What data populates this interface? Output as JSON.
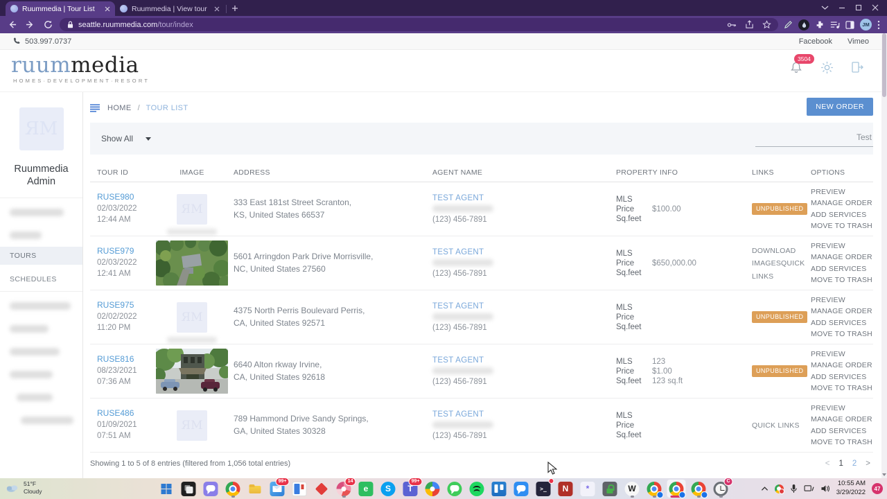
{
  "browser": {
    "tabs": [
      {
        "title": "Ruummedia | Tour List"
      },
      {
        "title": "Ruummedia | View tour"
      }
    ],
    "url_domain": "seattle.ruummedia.com",
    "url_path": "/tour/index",
    "profile_initials": "JM"
  },
  "site": {
    "topbar": {
      "phone": "503.997.0737",
      "link1": "Facebook",
      "link2": "Vimeo"
    },
    "header": {
      "logo_blue": "ruum",
      "logo_dark": "media",
      "tagline": "HOMES·DEVELOPMENT·RESORT",
      "notification_count": "3504"
    },
    "sidebar": {
      "profile_line1": "Ruummedia",
      "profile_line2": "Admin",
      "tours_label": "TOURS",
      "schedules_label": "SCHEDULES"
    },
    "breadcrumb": {
      "home": "HOME",
      "separator": "/",
      "current": "TOUR LIST"
    },
    "new_order_label": "NEW ORDER",
    "filter_label": "Show All",
    "search_value": "Test",
    "table": {
      "headers": [
        "TOUR ID",
        "IMAGE",
        "ADDRESS",
        "AGENT NAME",
        "PROPERTY INFO",
        "LINKS",
        "OPTIONS"
      ],
      "property_labels": [
        "MLS",
        "Price",
        "Sq.feet"
      ],
      "options": [
        "PREVIEW",
        "MANAGE ORDER",
        "ADD SERVICES",
        "MOVE TO TRASH"
      ],
      "rows": [
        {
          "tour_id": "RUSE980",
          "date": "02/03/2022",
          "time": "12:44 AM",
          "image": "placeholder",
          "caption_redacted": true,
          "address_line1": "333 East 181st Street Scranton,",
          "address_line2": "KS, United States 66537",
          "agent_name": "TEST AGENT",
          "agent_phone": "(123) 456-7891",
          "mls": "",
          "price": "$100.00",
          "sqfeet": "",
          "links": [],
          "badge": "UNPUBLISHED"
        },
        {
          "tour_id": "RUSE979",
          "date": "02/03/2022",
          "time": "12:41 AM",
          "image": "photo-aerial",
          "address_line1": "5601 Arringdon Park Drive Morrisville,",
          "address_line2": "NC, United States 27560",
          "agent_name": "TEST AGENT",
          "agent_phone": "(123) 456-7891",
          "mls": "",
          "price": "$650,000.00",
          "sqfeet": "",
          "links": [
            "DOWNLOAD IMAGES",
            "QUICK LINKS"
          ],
          "badge": ""
        },
        {
          "tour_id": "RUSE975",
          "date": "02/02/2022",
          "time": "11:20 PM",
          "image": "placeholder",
          "caption_redacted": true,
          "address_line1": "4375 North Perris Boulevard Perris,",
          "address_line2": "CA, United States 92571",
          "agent_name": "TEST AGENT",
          "agent_phone": "(123) 456-7891",
          "mls": "",
          "price": "",
          "sqfeet": "",
          "links": [],
          "badge": "UNPUBLISHED"
        },
        {
          "tour_id": "RUSE816",
          "date": "08/23/2021",
          "time": "07:36 AM",
          "image": "photo-building",
          "address_line1": "6640 Alton rkway Irvine,",
          "address_line2": "CA, United States 92618",
          "agent_name": "TEST AGENT",
          "agent_phone": "(123) 456-7891",
          "mls": "123",
          "price": "$1.00",
          "sqfeet": "123 sq.ft",
          "links": [],
          "badge": "UNPUBLISHED"
        },
        {
          "tour_id": "RUSE486",
          "date": "01/09/2021",
          "time": "07:51 AM",
          "image": "placeholder",
          "address_line1": "789 Hammond Drive Sandy Springs,",
          "address_line2": "GA, United States 30328",
          "agent_name": "TEST AGENT",
          "agent_phone": "(123) 456-7891",
          "mls": "",
          "price": "",
          "sqfeet": "",
          "links": [
            "QUICK LINKS"
          ],
          "badge": ""
        }
      ]
    },
    "footer": {
      "showing_text": "Showing 1 to 5 of 8 entries (filtered from 1,056 total entries)",
      "prev": "<",
      "page1": "1",
      "page2": "2",
      "next": ">"
    }
  },
  "taskbar": {
    "weather_temp": "51°F",
    "weather_condition": "Cloudy",
    "time": "10:55 AM",
    "date": "3/29/2022",
    "notification_count": "47",
    "icons": [
      {
        "name": "start-button",
        "kind": "squares"
      },
      {
        "name": "task-view-button",
        "kind": "taskview"
      },
      {
        "name": "teams-chat-icon",
        "kind": "bubble",
        "bg": "#8a7ee8"
      },
      {
        "name": "chrome-icon",
        "kind": "chrome",
        "dot": true
      },
      {
        "name": "file-explorer-icon",
        "kind": "folder"
      },
      {
        "name": "mail-icon",
        "kind": "mail",
        "badge": "99+",
        "badge_color": "#e8334a"
      },
      {
        "name": "store-app-icon",
        "kind": "split"
      },
      {
        "name": "diamond-app-icon",
        "kind": "diamond"
      },
      {
        "name": "community-app-icon",
        "kind": "pie2",
        "badge": "14",
        "badge_color": "#e8334a",
        "dot": true
      },
      {
        "name": "evernote-icon",
        "kind": "letter",
        "bg": "#2dbe60",
        "fg": "#ffffff",
        "glyph": "e"
      },
      {
        "name": "skype-icon",
        "kind": "letter",
        "bg": "#0aa0f0",
        "fg": "#ffffff",
        "glyph": "S",
        "round": true
      },
      {
        "name": "teams-icon",
        "kind": "letter",
        "bg": "#5b63d3",
        "fg": "#ffffff",
        "glyph": "T",
        "badge": "99+",
        "badge_color": "#e8334a"
      },
      {
        "name": "meet-app-icon",
        "kind": "pie"
      },
      {
        "name": "whatsapp-icon",
        "kind": "bubble",
        "bg": "#3fcc5a",
        "round": true
      },
      {
        "name": "spotify-icon",
        "kind": "spotify"
      },
      {
        "name": "trello-icon",
        "kind": "trello"
      },
      {
        "name": "messenger-icon",
        "kind": "bubble",
        "bg": "#2f8ef2"
      },
      {
        "name": "terminal-icon",
        "kind": "terminal",
        "glyph": ">_",
        "reddot": true
      },
      {
        "name": "notes-app-icon",
        "kind": "letter",
        "bg": "#b03028",
        "fg": "#ffffff",
        "glyph": "N"
      },
      {
        "name": "settings-app-icon",
        "kind": "letter",
        "bg": "#f2f2fa",
        "fg": "#7a6ae8",
        "glyph": "*"
      },
      {
        "name": "password-app-icon",
        "kind": "lock"
      },
      {
        "name": "wikipedia-icon",
        "kind": "letter",
        "bg": "#f7f7f7",
        "fg": "#222222",
        "glyph": "W",
        "round": true,
        "dot": true
      },
      {
        "name": "chrome-profile-1-icon",
        "kind": "chrome",
        "profile": true,
        "dot": true
      },
      {
        "name": "chrome-profile-2-icon",
        "kind": "chrome",
        "profile": true,
        "active": true
      },
      {
        "name": "chrome-profile-3-icon",
        "kind": "chrome",
        "profile": true,
        "dot": true
      },
      {
        "name": "clock-app-icon",
        "kind": "clock",
        "badge": "C",
        "badge_color": "#d6336c",
        "dot": true
      }
    ]
  },
  "colors": {
    "accent_blue": "#5b8fd0",
    "badge_orange": "#dd9f57",
    "notification_red": "#e8476b"
  }
}
